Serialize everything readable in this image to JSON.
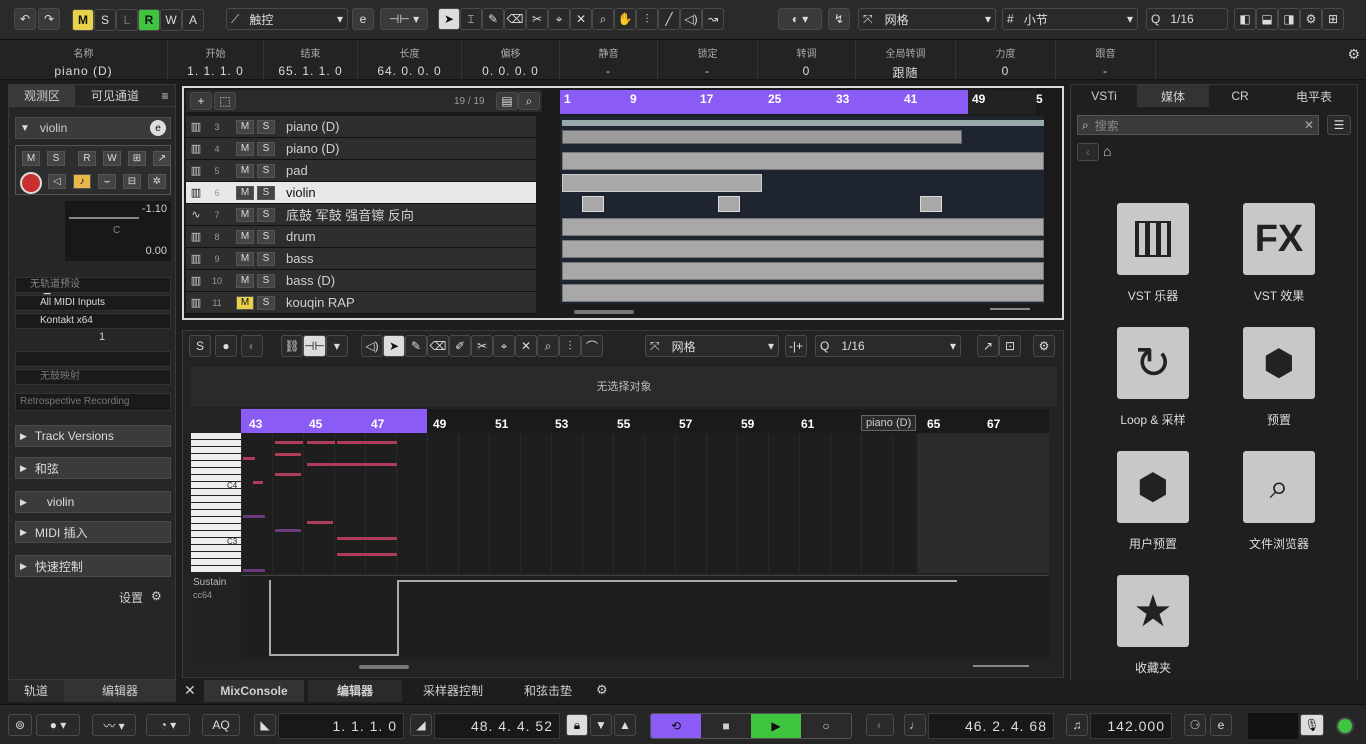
{
  "toolbar": {
    "undo_icon": "undo-icon",
    "redo_icon": "redo-icon",
    "mode_buttons": [
      "M",
      "S",
      "L",
      "R",
      "W",
      "A"
    ],
    "touch_mode": "触控",
    "grid_type": "网格",
    "grid_unit": "小节",
    "quantize": "1/16"
  },
  "infoline": {
    "columns": [
      {
        "label": "名称",
        "value": "piano (D)"
      },
      {
        "label": "开始",
        "value": "1. 1. 1.   0"
      },
      {
        "label": "结束",
        "value": "65. 1. 1.   0"
      },
      {
        "label": "长度",
        "value": "64. 0. 0.   0"
      },
      {
        "label": "偏移",
        "value": "0. 0. 0.   0"
      },
      {
        "label": "静音",
        "value": "-"
      },
      {
        "label": "锁定",
        "value": "-"
      },
      {
        "label": "转调",
        "value": "0"
      },
      {
        "label": "全局转调",
        "value": "跟随"
      },
      {
        "label": "力度",
        "value": "0"
      },
      {
        "label": "跟音",
        "value": "-"
      }
    ]
  },
  "inspector": {
    "tab_inspector": "观测区",
    "tab_visibility": "可见通道",
    "track_name": "violin",
    "volume": "-1.10",
    "pan": "C",
    "delay": "0.00",
    "no_preset": "无轨道预设",
    "midi_input": "All MIDI Inputs",
    "instrument": "Kontakt x64",
    "channel": "1",
    "no_map": "无鼓映射",
    "retro": "Retrospective Recording",
    "sections": [
      "Track Versions",
      "和弦",
      "violin",
      "MIDI 插入",
      "快速控制"
    ],
    "settings": "设置"
  },
  "project": {
    "track_count": "19 / 19",
    "ruler": [
      "1",
      "9",
      "17",
      "25",
      "33",
      "41",
      "49",
      "5"
    ],
    "tracks": [
      {
        "num": "3",
        "name": "piano (D)",
        "type": "midi"
      },
      {
        "num": "4",
        "name": "piano (D)",
        "type": "midi"
      },
      {
        "num": "5",
        "name": "pad",
        "type": "midi"
      },
      {
        "num": "6",
        "name": "violin",
        "type": "midi",
        "selected": true
      },
      {
        "num": "7",
        "name": "底鼓 军鼓 强音镲 反向",
        "type": "audio"
      },
      {
        "num": "8",
        "name": "drum",
        "type": "midi"
      },
      {
        "num": "9",
        "name": "bass",
        "type": "midi"
      },
      {
        "num": "10",
        "name": "bass (D)",
        "type": "midi"
      },
      {
        "num": "11",
        "name": "kouqin RAP",
        "type": "midi"
      }
    ]
  },
  "editor": {
    "grid_type": "网格",
    "quantize": "1/16",
    "status": "无选择对象",
    "ruler": [
      "43",
      "45",
      "47",
      "49",
      "51",
      "53",
      "55",
      "57",
      "59",
      "61",
      "65",
      "67"
    ],
    "part_label": "piano (D)",
    "key_c4": "C4",
    "key_c3": "C3",
    "controller_name": "Sustain",
    "controller_cc": "cc64"
  },
  "right_zone": {
    "tabs": [
      "VSTi",
      "媒体",
      "CR",
      "电平表"
    ],
    "search_placeholder": "搜索",
    "items": [
      {
        "label": "VST 乐器",
        "icon": "piano-keys-icon"
      },
      {
        "label": "VST 效果",
        "icon": "fx-icon"
      },
      {
        "label": "Loop & 采样",
        "icon": "loop-icon"
      },
      {
        "label": "预置",
        "icon": "hexagons-icon"
      },
      {
        "label": "用户预置",
        "icon": "user-preset-icon"
      },
      {
        "label": "文件浏览器",
        "icon": "file-browser-icon"
      },
      {
        "label": "收藏夹",
        "icon": "star-icon"
      }
    ]
  },
  "bottom_tabs": {
    "left": [
      "轨道",
      "编辑器"
    ],
    "middle": [
      "MixConsole",
      "编辑器",
      "采样器控制",
      "和弦击垫"
    ]
  },
  "transport": {
    "aq": "AQ",
    "left_locator": "1. 1. 1.   0",
    "right_locator": "48. 4. 4. 52",
    "position": "46. 2. 4. 68",
    "tempo": "142.000"
  },
  "colors": {
    "accent_purple": "#8a5cf5",
    "mode_m": "#e8d24a",
    "mode_r": "#3ec43e",
    "play_green": "#3ec43e",
    "note_red": "#b23a5a"
  }
}
